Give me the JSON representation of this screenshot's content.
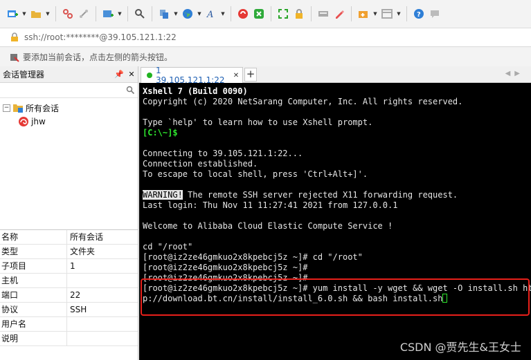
{
  "toolbar": {
    "icons": [
      "new-session-icon",
      "open-folder-icon",
      "disconnect-icon",
      "reconnect-icon",
      "new-tab-icon",
      "find-icon",
      "copy-icon",
      "globe-icon",
      "font-icon",
      "xftp-icon",
      "xmanager-icon",
      "fullscreen-icon",
      "lock-icon",
      "keyboard-icon",
      "highlight-icon",
      "compose-icon",
      "layout-icon",
      "help-icon",
      "chat-icon"
    ]
  },
  "address": {
    "value": "ssh://root:********@39.105.121.1:22"
  },
  "hint": {
    "text": "要添加当前会话，点击左侧的箭头按钮。"
  },
  "session_panel": {
    "title": "会话管理器",
    "pin": "ᴘ",
    "close": "✕",
    "search_value": "",
    "tree": {
      "root_expander": "−",
      "root_label": "所有会话",
      "child_label": "jhw"
    },
    "properties": [
      {
        "key": "名称",
        "value": "所有会话"
      },
      {
        "key": "类型",
        "value": "文件夹"
      },
      {
        "key": "子项目",
        "value": "1"
      },
      {
        "key": "主机",
        "value": ""
      },
      {
        "key": "端口",
        "value": "22"
      },
      {
        "key": "协议",
        "value": "SSH"
      },
      {
        "key": "用户名",
        "value": ""
      },
      {
        "key": "说明",
        "value": ""
      }
    ]
  },
  "tabs": {
    "active_label": "1 39.105.121.1:22",
    "close": "✕",
    "new": "+",
    "nav": "◀▶"
  },
  "terminal": {
    "lines": {
      "l1": "Xshell 7 (Build 0090)",
      "l2": "Copyright (c) 2020 NetSarang Computer, Inc. All rights reserved.",
      "l3": "",
      "l4": "Type `help' to learn how to use Xshell prompt.",
      "l5": "[C:\\~]$",
      "l6": "",
      "l7": "Connecting to 39.105.121.1:22...",
      "l8": "Connection established.",
      "l9": "To escape to local shell, press 'Ctrl+Alt+]'.",
      "l10": "",
      "l11_tag": "WARNING!",
      "l11_rest": " The remote SSH server rejected X11 forwarding request.",
      "l12": "Last login: Thu Nov 11 11:27:41 2021 from 127.0.0.1",
      "l13": "",
      "l14": "Welcome to Alibaba Cloud Elastic Compute Service !",
      "l15": "",
      "l16": "cd \"/root\"",
      "l17": "[root@iz2ze46gmkuo2x8kpebcj5z ~]# cd \"/root\"",
      "l18": "[root@iz2ze46gmkuo2x8kpebcj5z ~]#",
      "l19": "[root@iz2ze46gmkuo2x8kpebcj5z ~]#",
      "l20": "[root@iz2ze46gmkuo2x8kpebcj5z ~]# yum install -y wget && wget -O install.sh htt",
      "l21": "p://download.bt.cn/install/install_6.0.sh && bash install.sh"
    }
  },
  "watermark": "CSDN @贾先生&王女士",
  "colors": {
    "terminal_bg": "#000000",
    "prompt_green": "#2ee82e",
    "highlight_red": "#e8201a",
    "tab_text": "#1e5fb3"
  }
}
